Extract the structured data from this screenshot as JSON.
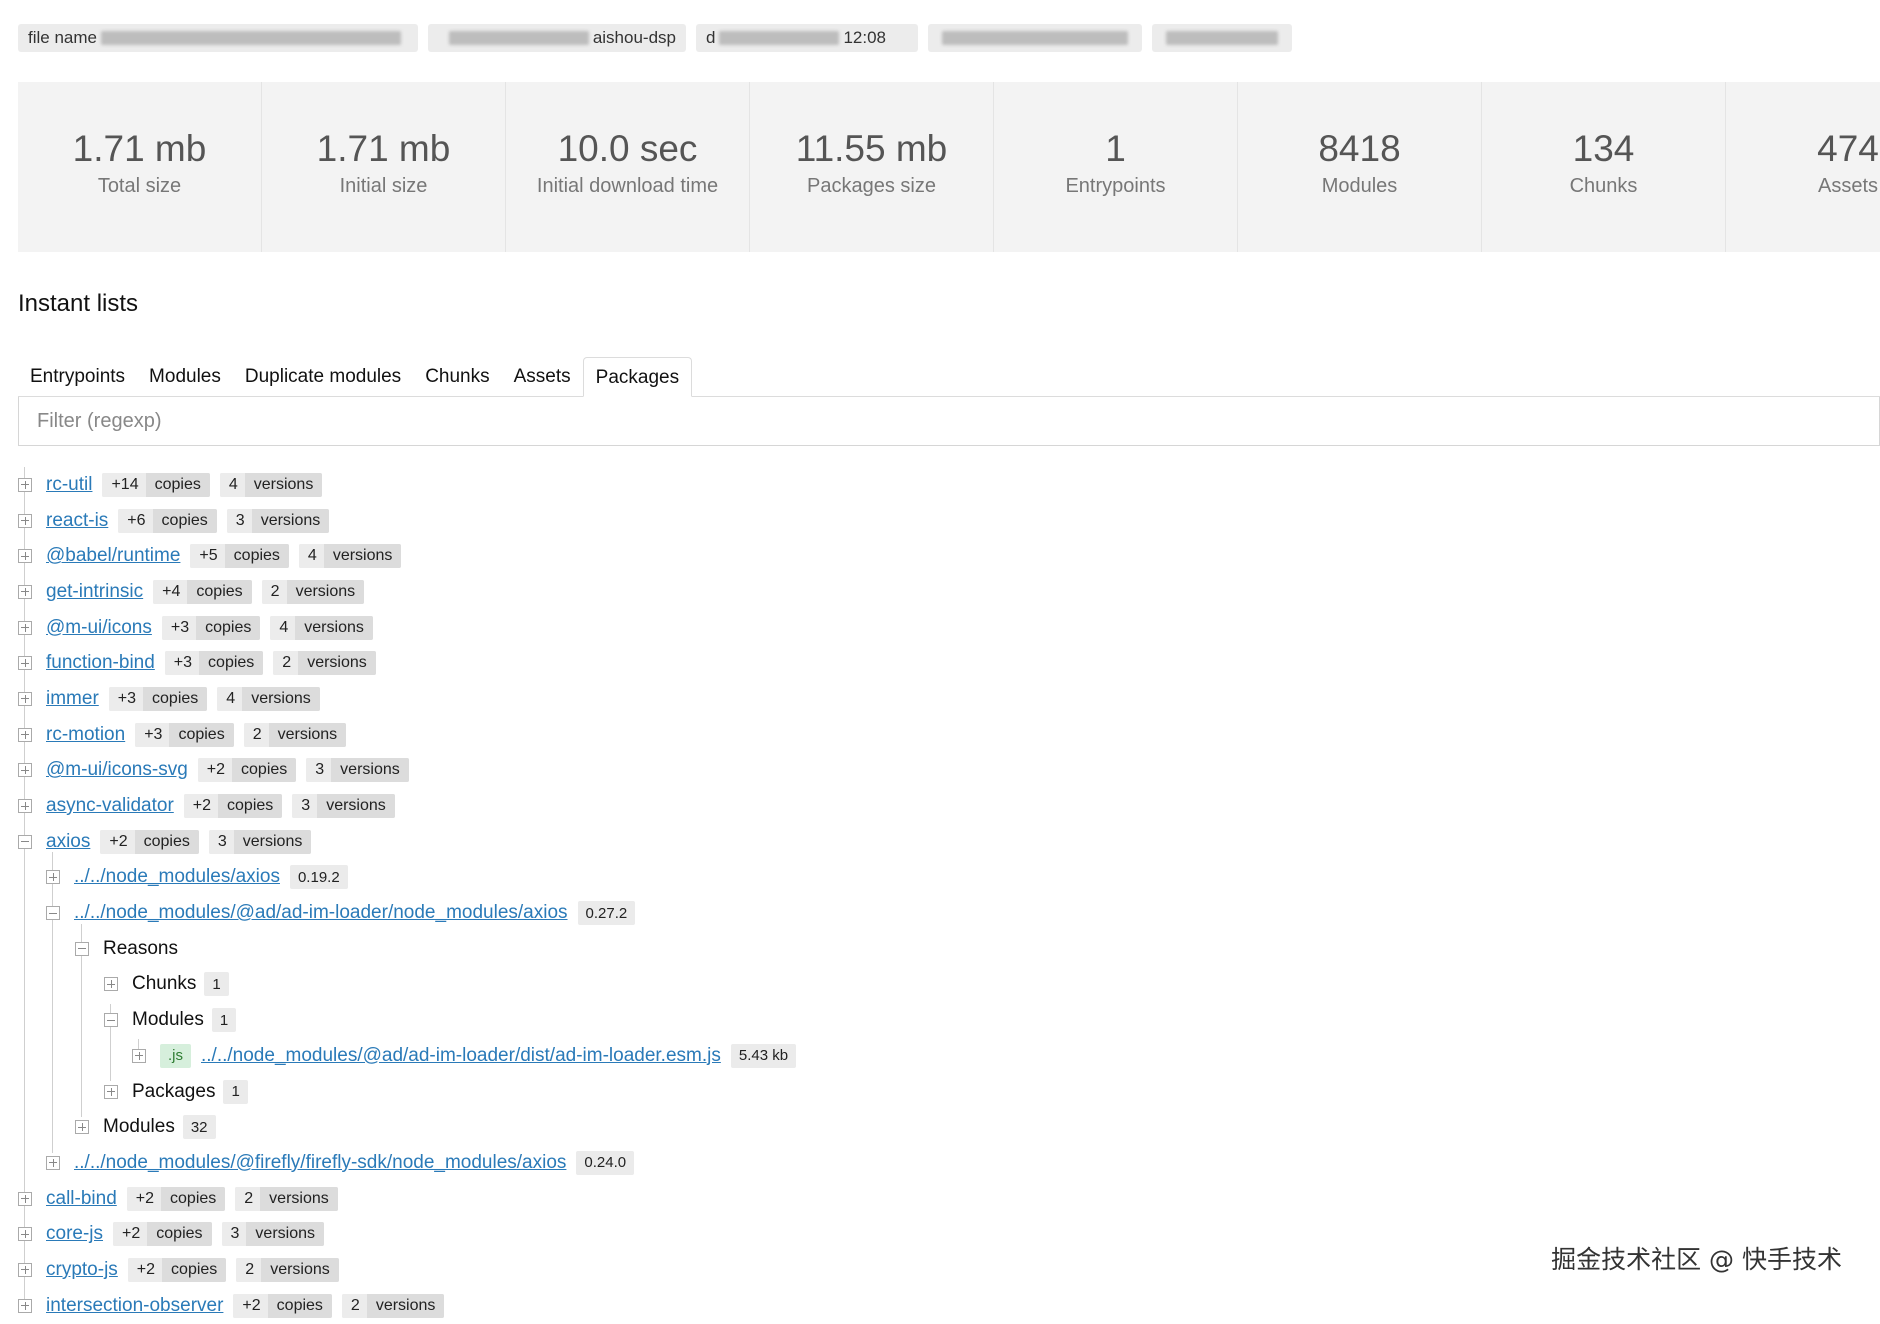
{
  "header": {
    "badges": [
      {
        "text_left": "file name",
        "text_right": "",
        "width": 400
      },
      {
        "text_left": "",
        "text_right": "aishou-dsp",
        "width": 258
      },
      {
        "text_left": "d",
        "text_right": "12:08",
        "width": 222
      },
      {
        "text_left": "",
        "text_right": "",
        "width": 214
      },
      {
        "text_left": "",
        "text_right": "",
        "width": 140
      }
    ]
  },
  "stats": [
    {
      "value": "1.71 mb",
      "label": "Total size"
    },
    {
      "value": "1.71 mb",
      "label": "Initial size"
    },
    {
      "value": "10.0 sec",
      "label": "Initial download time"
    },
    {
      "value": "11.55 mb",
      "label": "Packages size"
    },
    {
      "value": "1",
      "label": "Entrypoints"
    },
    {
      "value": "8418",
      "label": "Modules"
    },
    {
      "value": "134",
      "label": "Chunks"
    },
    {
      "value": "474",
      "label": "Assets"
    }
  ],
  "section_title": "Instant lists",
  "tabs": [
    {
      "label": "Entrypoints",
      "active": false
    },
    {
      "label": "Modules",
      "active": false
    },
    {
      "label": "Duplicate modules",
      "active": false
    },
    {
      "label": "Chunks",
      "active": false
    },
    {
      "label": "Assets",
      "active": false
    },
    {
      "label": "Packages",
      "active": true
    }
  ],
  "filter": {
    "placeholder": "Filter (regexp)",
    "value": ""
  },
  "copies_label": "copies",
  "versions_label": "versions",
  "packages_before": [
    {
      "name": "rc-util",
      "copies": "+14",
      "versions": "4"
    },
    {
      "name": "react-is",
      "copies": "+6",
      "versions": "3"
    },
    {
      "name": "@babel/runtime",
      "copies": "+5",
      "versions": "4"
    },
    {
      "name": "get-intrinsic",
      "copies": "+4",
      "versions": "2"
    },
    {
      "name": "@m-ui/icons",
      "copies": "+3",
      "versions": "4"
    },
    {
      "name": "function-bind",
      "copies": "+3",
      "versions": "2"
    },
    {
      "name": "immer",
      "copies": "+3",
      "versions": "4"
    },
    {
      "name": "rc-motion",
      "copies": "+3",
      "versions": "2"
    },
    {
      "name": "@m-ui/icons-svg",
      "copies": "+2",
      "versions": "3"
    },
    {
      "name": "async-validator",
      "copies": "+2",
      "versions": "3"
    }
  ],
  "expanded_package": {
    "name": "axios",
    "copies": "+2",
    "versions": "3",
    "instance1": {
      "path": "../../node_modules/axios",
      "version": "0.19.2"
    },
    "instance2": {
      "path": "../../node_modules/@ad/ad-im-loader/node_modules/axios",
      "version": "0.27.2",
      "reasons_label": "Reasons",
      "chunks_label": "Chunks",
      "chunks_count": "1",
      "modules_label": "Modules",
      "modules_count": "1",
      "module_ext": ".js",
      "module_path": "../../node_modules/@ad/ad-im-loader/dist/ad-im-loader.esm.js",
      "module_size": "5.43 kb",
      "packages_label": "Packages",
      "packages_count": "1",
      "all_modules_label": "Modules",
      "all_modules_count": "32"
    },
    "instance3": {
      "path": "../../node_modules/@firefly/firefly-sdk/node_modules/axios",
      "version": "0.24.0"
    }
  },
  "packages_after": [
    {
      "name": "call-bind",
      "copies": "+2",
      "versions": "2"
    },
    {
      "name": "core-js",
      "copies": "+2",
      "versions": "3"
    },
    {
      "name": "crypto-js",
      "copies": "+2",
      "versions": "2"
    },
    {
      "name": "intersection-observer",
      "copies": "+2",
      "versions": "2"
    }
  ],
  "watermark": "掘金技术社区 @ 快手技术"
}
